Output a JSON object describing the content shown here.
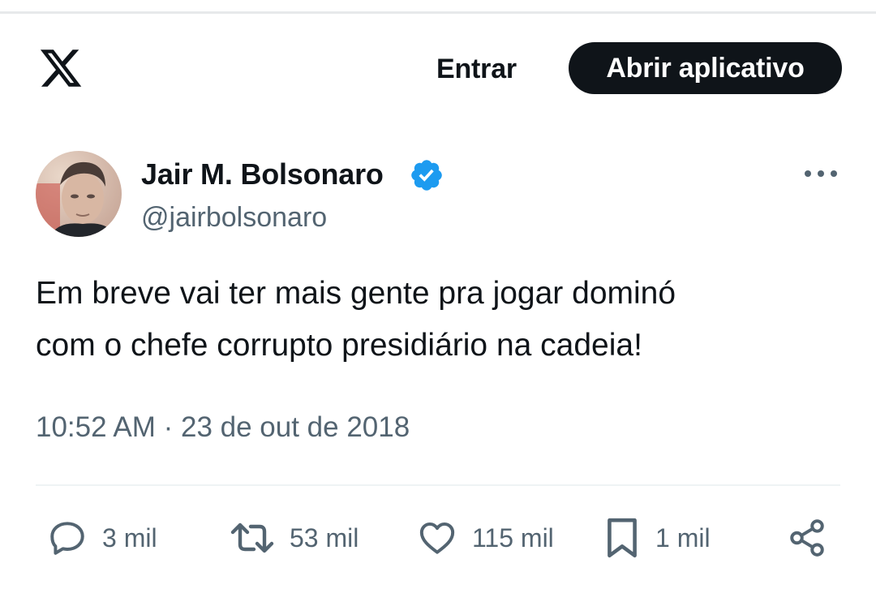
{
  "header": {
    "logo_icon": "x-logo-icon",
    "login_label": "Entrar",
    "open_app_label": "Abrir aplicativo"
  },
  "tweet": {
    "author": {
      "name": "Jair M. Bolsonaro",
      "handle": "@jairbolsonaro",
      "verified": true,
      "verified_color": "#1d9bf0"
    },
    "text_line_1": "Em breve vai ter mais gente pra jogar dominó",
    "text_line_2": "com o chefe corrupto presidiário na cadeia!",
    "timestamp": "10:52 AM · 23 de out de 2018",
    "actions": {
      "replies": "3 mil",
      "reposts": "53 mil",
      "likes": "115 mil",
      "bookmarks": "1 mil"
    }
  },
  "colors": {
    "text_primary": "#0f1419",
    "text_secondary": "#536471",
    "button_bg": "#0f1419",
    "verified": "#1d9bf0"
  }
}
